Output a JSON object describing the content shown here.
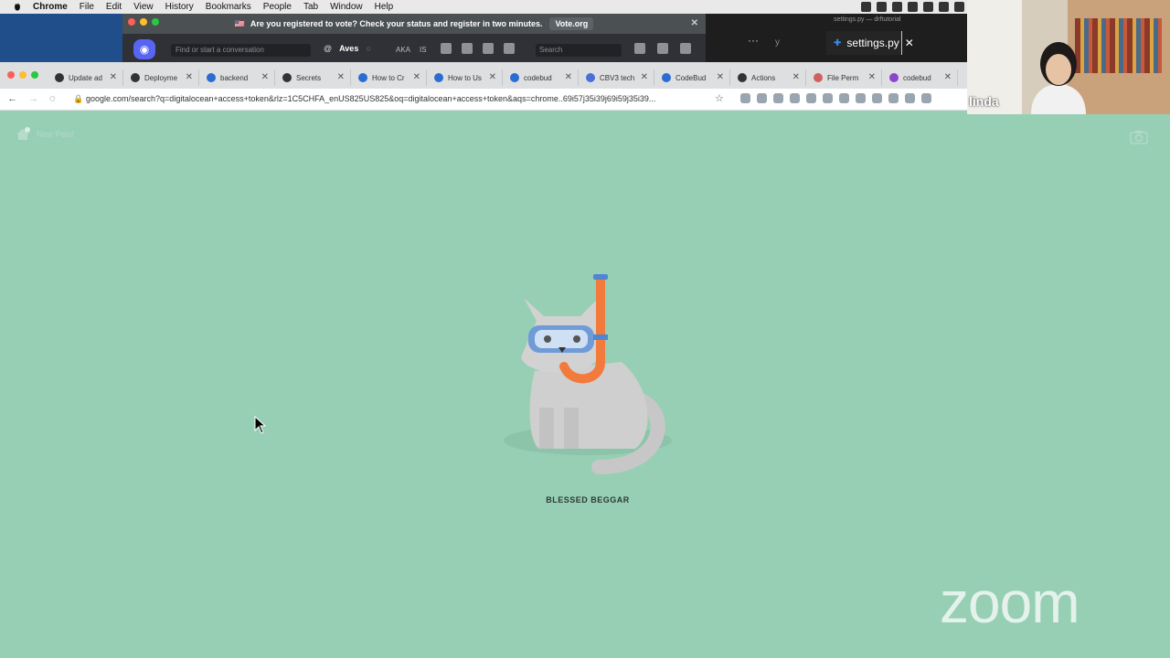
{
  "menubar": {
    "items": [
      "Chrome",
      "File",
      "Edit",
      "View",
      "History",
      "Bookmarks",
      "People",
      "Tab",
      "Window",
      "Help"
    ]
  },
  "discord": {
    "notice": "Are you registered to vote? Check your status and register in two minutes.",
    "notice_link": "Vote.org",
    "search_placeholder": "Find or start a conversation",
    "channel_name": "Aves",
    "channel_extra": "AKA",
    "channel_extra2": "IS",
    "header_search": "Search"
  },
  "vscode": {
    "window_title": "settings.py — drftutorial",
    "tab_label": "settings.py",
    "more": "···",
    "y": "y"
  },
  "tabs": [
    {
      "label": "Update ad",
      "color": "#333"
    },
    {
      "label": "Deployme",
      "color": "#333"
    },
    {
      "label": "backend",
      "color": "#2b6cd3"
    },
    {
      "label": "Secrets",
      "color": "#333"
    },
    {
      "label": "How to Cr",
      "color": "#2b6cd3"
    },
    {
      "label": "How to Us",
      "color": "#2b6cd3"
    },
    {
      "label": "codebud",
      "color": "#2b6cd3"
    },
    {
      "label": "CBV3 tech",
      "color": "#4a6fd8"
    },
    {
      "label": "CodeBud",
      "color": "#2b6cd3"
    },
    {
      "label": "Actions",
      "color": "#333"
    },
    {
      "label": "File Perm",
      "color": "#d06060"
    },
    {
      "label": "codebud",
      "color": "#8b46c9"
    }
  ],
  "address": {
    "url": "google.com/search?q=digitalocean+access+token&rlz=1C5CHFA_enUS825US825&oq=digitalocean+access+token&aqs=chrome..69i57j35i39j69i59j35i39..."
  },
  "page": {
    "home_label": "New Pets!",
    "caption": "BLESSED BEGGAR"
  },
  "webcam": {
    "name": "linda"
  },
  "zoom": {
    "logo": "zoom"
  }
}
